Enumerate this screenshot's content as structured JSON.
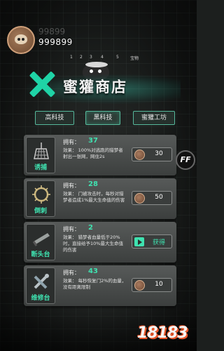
{
  "hud": {
    "money_ghost": "99899",
    "money": "999899"
  },
  "top_tabs": [
    "1",
    "2",
    "3",
    "4",
    "5",
    "宝物"
  ],
  "title": "蜜獾商店",
  "categories": [
    {
      "label": "高科技",
      "active": false
    },
    {
      "label": "黑科技",
      "active": true
    },
    {
      "label": "蜜獾工坊",
      "active": false
    }
  ],
  "owned_label": "拥有：",
  "items": [
    {
      "name": "诱捕",
      "owned": "37",
      "effect": "效果：   100%对逃跑的猎梦者射出一张网，网住2s",
      "price": "30",
      "icon": "net-trap-icon",
      "action": "buy"
    },
    {
      "name": "倒刺",
      "owned": "28",
      "effect": "效果：   门被攻击时，每秒对猎梦者造成1%最大生命值的伤害",
      "price": "50",
      "icon": "spike-ring-icon",
      "action": "buy"
    },
    {
      "name": "断头台",
      "owned": "2",
      "effect": "效果：   猎梦者血量低于20%时，直接给予10%最大生命值的伤害",
      "price": "获得",
      "icon": "guillotine-icon",
      "action": "get"
    },
    {
      "name": "维修台",
      "owned": "43",
      "effect": "效果：   每秒恢复门2%的血量，没有距离限制",
      "price": "10",
      "icon": "repair-tools-icon",
      "action": "buy"
    }
  ],
  "ff_label": "FF",
  "watermark": "18183",
  "colors": {
    "accent": "#3fe2b0",
    "card": "#4a4d4c",
    "tab_border": "#56b89b"
  }
}
